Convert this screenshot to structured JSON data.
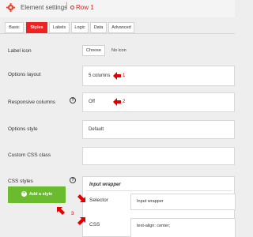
{
  "header": {
    "title": "Element settings",
    "separator": "|",
    "row_label": "Row 1"
  },
  "tabs": [
    {
      "label": "Basic"
    },
    {
      "label": "Styles"
    },
    {
      "label": "Labels"
    },
    {
      "label": "Logic"
    },
    {
      "label": "Data"
    },
    {
      "label": "Advanced"
    }
  ],
  "active_tab": "Styles",
  "fields": {
    "label_icon": {
      "label": "Label icon",
      "choose": "Choose",
      "no_icon": "No icon"
    },
    "options_layout": {
      "label": "Options layout",
      "value": "5 columns"
    },
    "responsive_columns": {
      "label": "Responsive columns",
      "value": "Off"
    },
    "options_style": {
      "label": "Options style",
      "value": "Default"
    },
    "custom_css_class": {
      "label": "Custom CSS class",
      "value": ""
    },
    "css_styles": {
      "label": "CSS styles",
      "add_button": "Add a style"
    }
  },
  "style_panel": {
    "title": "Input wrapper",
    "selector_label": "Selector",
    "selector_value": "Input wrapper",
    "css_label": "CSS",
    "css_value": "text-align: center;"
  },
  "annotations": {
    "one": "1",
    "two": "2",
    "three": "3"
  },
  "help_glyph": "?",
  "plus_glyph": "+",
  "colors": {
    "accent": "#ee2222",
    "annotation": "#e00000",
    "add_button": "#6abb2e",
    "background": "#eeeeee"
  }
}
